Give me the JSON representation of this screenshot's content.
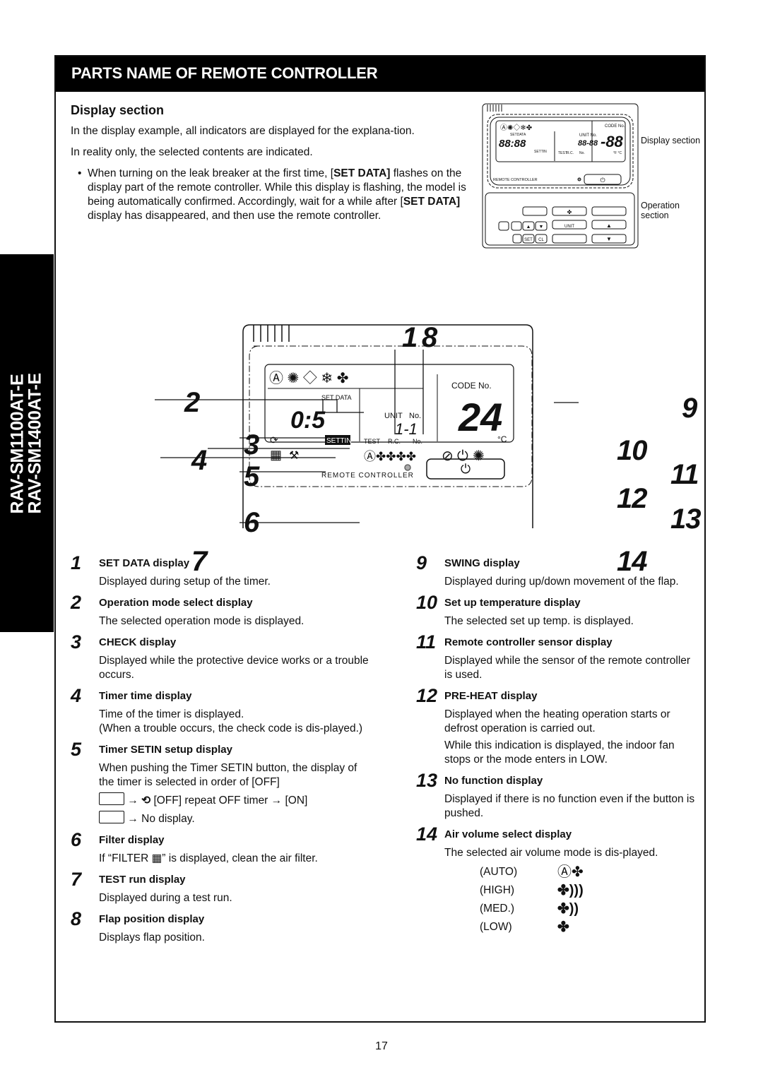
{
  "side_tab": {
    "models": [
      "RAV-SM1100AT-E",
      "RAV-SM1400AT-E"
    ]
  },
  "header": {
    "title": "PARTS NAME OF REMOTE CONTROLLER"
  },
  "intro": {
    "heading": "Display section",
    "paragraphs": [
      "In the display example, all indicators are displayed for the explana-tion.",
      "In reality only, the selected contents are indicated."
    ],
    "bullet": {
      "part1": "When turning on the leak breaker at the first time, [",
      "bold1": "SET DATA]",
      "part2": " flashes on the display part of the remote controller. While this display is flashing, the model is being automatically confirmed. Accordingly, wait for a while after [",
      "bold2": "SET DATA]",
      "part3": " display has disappeared, and then use the remote controller."
    }
  },
  "small_remote": {
    "display_label": "Display section",
    "operation_label": "Operation section",
    "lcd": {
      "code_no": "CODE No.",
      "unit_no": "UNIT No.",
      "set_data": "SETDATA",
      "time": "88:88",
      "unit_digits": "88-88",
      "temp": "-88",
      "rc": "R.C.",
      "no": "No.",
      "test": "TEST",
      "setin": "SETTIN",
      "temp_unit": "°F °C",
      "brand_text": "REMOTE CONTROLLER"
    },
    "buttons": {
      "unit": "UNIT",
      "set": "SET",
      "cl": "CL"
    }
  },
  "diagram": {
    "callouts": [
      "1",
      "8",
      "2",
      "9",
      "3",
      "10",
      "4",
      "11",
      "5",
      "12",
      "6",
      "13",
      "7",
      "14"
    ],
    "lcd": {
      "set_data": "SET DATA",
      "time": "0:5",
      "unit_label": "UNIT",
      "no_label": "No.",
      "unit_digits": "1-1",
      "rc": "R.C.",
      "no2": "No.",
      "test": "TEST",
      "setin": "SETTIN",
      "code_no": "CODE No.",
      "temp": "24",
      "temp_unit": "°C",
      "brand_text": "REMOTE CONTROLLER"
    }
  },
  "items_left": [
    {
      "num": "1",
      "title": "SET DATA display",
      "desc": [
        "Displayed during setup of the timer."
      ]
    },
    {
      "num": "2",
      "title": "Operation mode select display",
      "desc": [
        "The selected operation mode is displayed."
      ]
    },
    {
      "num": "3",
      "title": "CHECK display",
      "desc": [
        "Displayed while the protective device works or a trouble occurs."
      ]
    },
    {
      "num": "4",
      "title": "Timer time display",
      "desc": [
        "Time of the timer is displayed.",
        "(When a trouble occurs, the check code is dis-played.)"
      ]
    },
    {
      "num": "5",
      "title": "Timer SETIN setup display",
      "desc": [
        "When pushing the Timer SETIN button, the display of the timer is selected in order of [OFF]"
      ],
      "seq1": "→",
      "seq1_text": "[OFF] repeat OFF timer → [ON]",
      "seq2": "→ No display."
    },
    {
      "num": "6",
      "title": "Filter display",
      "desc_pre": "If “FILTER",
      "desc_post": "” is displayed, clean the air filter."
    },
    {
      "num": "7",
      "title": "TEST run display",
      "desc": [
        "Displayed during a test run."
      ]
    },
    {
      "num": "8",
      "title": "Flap position display",
      "desc": [
        "Displays flap position."
      ]
    }
  ],
  "items_right": [
    {
      "num": "9",
      "title": "SWING display",
      "desc": [
        "Displayed during up/down movement of the flap."
      ]
    },
    {
      "num": "10",
      "title": "Set up temperature display",
      "desc": [
        "The selected set up temp. is displayed."
      ]
    },
    {
      "num": "11",
      "title": "Remote controller sensor display",
      "desc": [
        "Displayed while the sensor of the remote controller is used."
      ]
    },
    {
      "num": "12",
      "title": "PRE-HEAT display",
      "desc": [
        "Displayed when the heating operation starts or defrost operation is carried out.",
        "While this indication is displayed, the indoor fan stops or the mode enters in LOW."
      ]
    },
    {
      "num": "13",
      "title": "No function display",
      "desc": [
        "Displayed if there is no function even if the button is pushed."
      ]
    },
    {
      "num": "14",
      "title": "Air volume select display",
      "desc": [
        "The selected air volume mode is dis-played."
      ],
      "fan_modes": [
        {
          "label": "(AUTO)",
          "icon": "auto-fan-icon"
        },
        {
          "label": "(HIGH)",
          "icon": "fan-high-icon"
        },
        {
          "label": "(MED.)",
          "icon": "fan-med-icon"
        },
        {
          "label": "(LOW)",
          "icon": "fan-low-icon"
        }
      ]
    }
  ],
  "page_number": "17"
}
